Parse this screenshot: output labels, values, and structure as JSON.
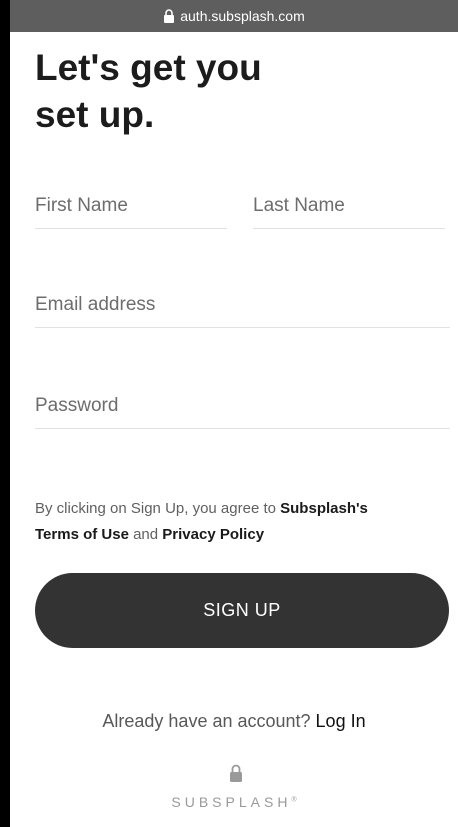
{
  "browser": {
    "url": "auth.subsplash.com"
  },
  "heading": {
    "line1": "Let's get you",
    "line2": "set up."
  },
  "form": {
    "first_name_placeholder": "First Name",
    "last_name_placeholder": "Last Name",
    "email_placeholder": "Email address",
    "password_placeholder": "Password"
  },
  "legal": {
    "prefix": "By clicking on Sign Up, you agree to ",
    "brand": "Subsplash's",
    "terms": "Terms of Use",
    "and": " and ",
    "privacy": "Privacy Policy"
  },
  "signup_button": "SIGN UP",
  "login": {
    "prompt": "Already have an account? ",
    "link": "Log In"
  },
  "footer": {
    "brand": "SUBSPLASH",
    "mark": "®"
  },
  "colors": {
    "button": "#333333",
    "url_bar": "#5e5e5e",
    "underline": "#e2e2e2"
  },
  "icons": {
    "url_lock": "lock-icon",
    "footer_lock": "lock-icon"
  }
}
